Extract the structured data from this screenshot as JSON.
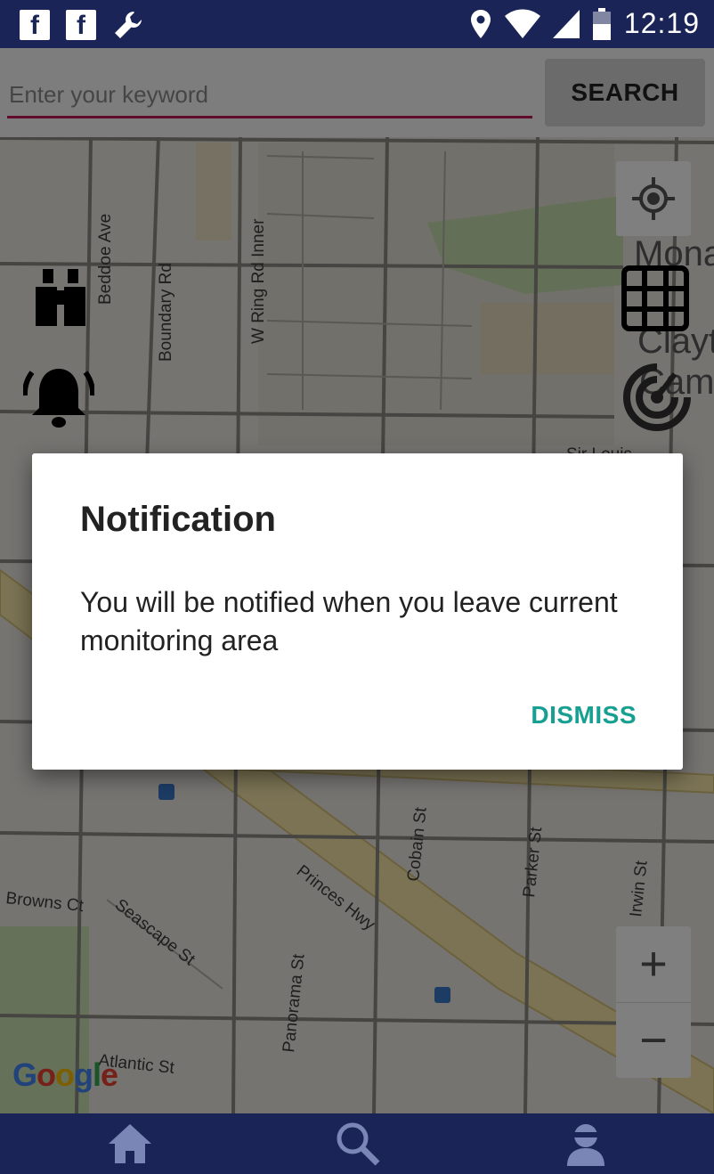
{
  "status_bar": {
    "time": "12:19",
    "left_icons": [
      "facebook-icon",
      "facebook-icon",
      "wrench-icon"
    ],
    "right_icons": [
      "location-pin-icon",
      "wifi-icon",
      "cell-signal-icon",
      "battery-icon"
    ]
  },
  "search": {
    "placeholder": "Enter your keyword",
    "value": "",
    "button_label": "SEARCH",
    "accent_color": "#c2185b"
  },
  "map": {
    "street_labels": [
      "Beddoe Ave",
      "Boundary Rd",
      "W Ring Rd Inner",
      "Browns Ct",
      "Seascape St",
      "Princes Hwy",
      "Panorama St",
      "Cobain St",
      "Parker St",
      "Irwin St",
      "Atlantic St",
      "Sir Louis",
      "Mona",
      "Clayt",
      "Camp"
    ],
    "logo": "Google",
    "left_tools": [
      "binoculars-icon",
      "bell-ring-icon"
    ],
    "right_tools": [
      "my-location-icon",
      "grid-icon",
      "radar-icon"
    ],
    "zoom_in": "+",
    "zoom_out": "−"
  },
  "dialog": {
    "title": "Notification",
    "message": "You will be notified when you leave current monitoring area",
    "button_label": "DISMISS",
    "button_color": "#17a092"
  },
  "bottom_nav": {
    "items": [
      "home-icon",
      "search-icon",
      "profile-icon"
    ]
  },
  "colors": {
    "primary_dark": "#1a2456"
  }
}
